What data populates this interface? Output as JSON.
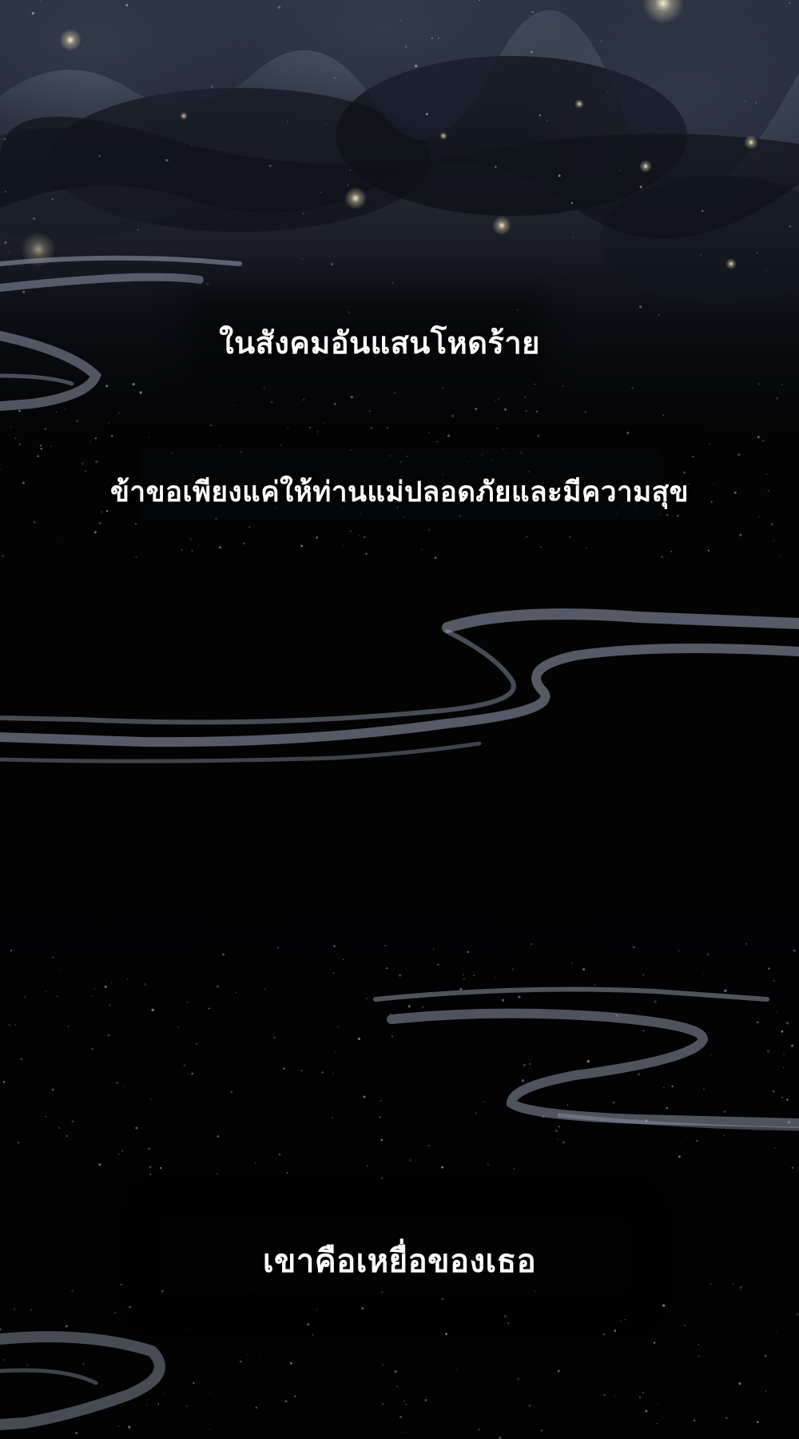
{
  "captions": {
    "line1": "ในสังคมอันแสนโหดร้าย",
    "line2": "ข้าขอเพียงแค่ให้ท่านแม่ปลอดภัยและมีความสุข",
    "line3": "เขาคือเหยื่อของเธอ"
  },
  "colors": {
    "background": "#020203",
    "sky_top": "#3b4456",
    "mist": "#9aa3b8",
    "text": "#ffffff"
  }
}
